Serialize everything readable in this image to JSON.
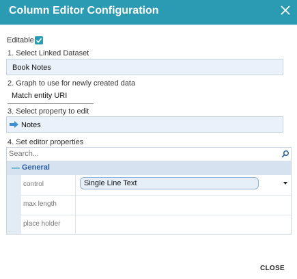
{
  "dialog": {
    "title": "Column Editor Configuration"
  },
  "editable": {
    "label": "Editable",
    "checked": true
  },
  "step1": {
    "label": "1. Select Linked Dataset",
    "value": "Book Notes"
  },
  "step2": {
    "label": "2. Graph to use for newly created data",
    "value": "Match entity URI"
  },
  "step3": {
    "label": "3. Select property to edit",
    "value": "Notes"
  },
  "step4": {
    "label": "4. Set editor properties",
    "search_placeholder": "Search...",
    "group": {
      "collapse_symbol": "—",
      "label": "General"
    },
    "rows": [
      {
        "name": "control",
        "value": "Single Line Text"
      },
      {
        "name": "max length",
        "value": ""
      },
      {
        "name": "place holder",
        "value": ""
      }
    ]
  },
  "footer": {
    "close_label": "CLOSE"
  },
  "colors": {
    "accent": "#2b9bb3",
    "field_bg": "#eaf1fa",
    "group_bg": "#d6e2f0",
    "arrow": "#3d8fd1"
  }
}
